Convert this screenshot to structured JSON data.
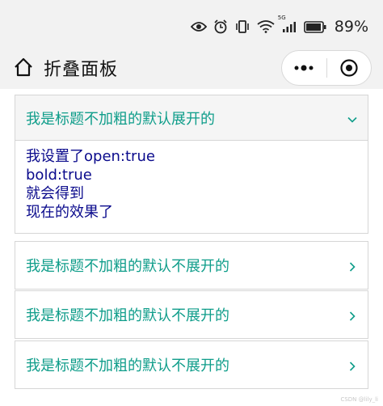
{
  "status_bar": {
    "battery_percent": "89%",
    "network_label": "5G"
  },
  "nav": {
    "title": "折叠面板"
  },
  "panels": [
    {
      "title": "我是标题不加粗的默认展开的",
      "expanded": true,
      "body_lines": [
        "我设置了open:true",
        "bold:true",
        "就会得到",
        "现在的效果了"
      ]
    },
    {
      "title": "我是标题不加粗的默认不展开的",
      "expanded": false
    },
    {
      "title": "我是标题不加粗的默认不展开的",
      "expanded": false
    },
    {
      "title": "我是标题不加粗的默认不展开的",
      "expanded": false
    }
  ],
  "footer": {
    "mark": "CSDN @lily_li"
  },
  "colors": {
    "title_text": "#0f9d8a",
    "body_text": "#0a0a8c",
    "border": "#d6d6d6",
    "chrome_bg": "#f2f2f2"
  }
}
